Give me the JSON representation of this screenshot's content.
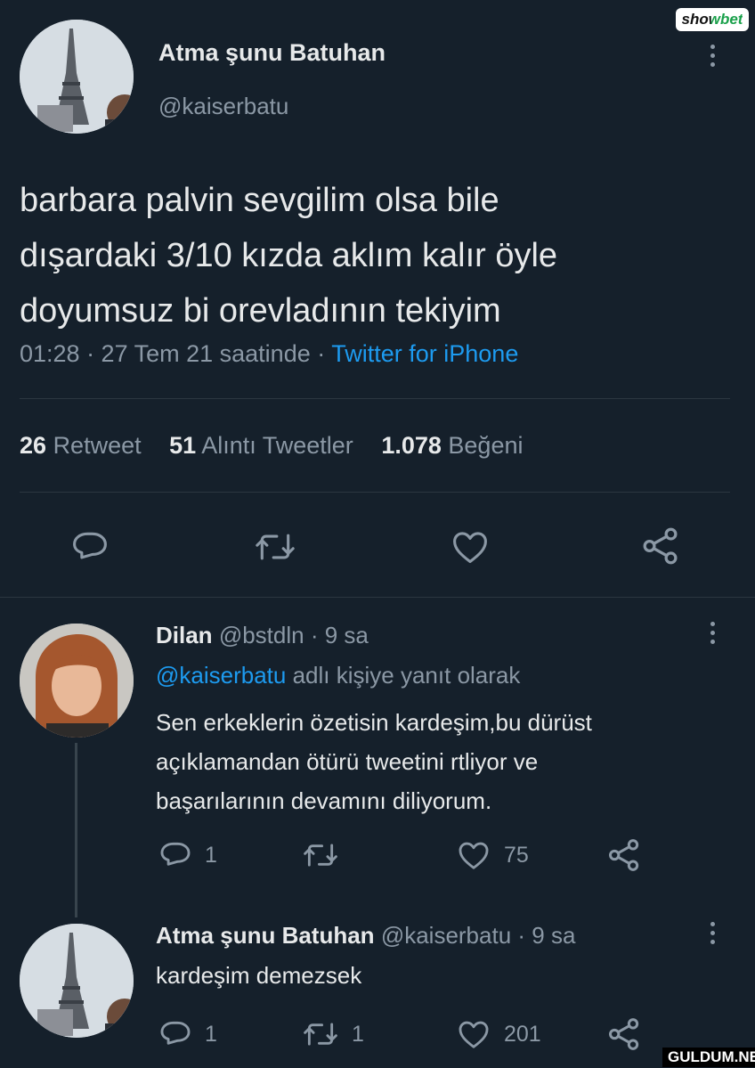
{
  "watermark_top": "showbet",
  "watermark_bottom": "GULDUM.NET",
  "tweet": {
    "author_name": "Atma şunu Batuhan",
    "handle": "@kaiserbatu",
    "text_lines": [
      "barbara palvin sevgilim olsa bile",
      "dışardaki 3/10 kızda aklım kalır öyle",
      "doyumsuz bi orevladının tekiyim"
    ],
    "meta_time": "01:28 · 27 Tem 21 saatinde ·",
    "meta_source": "Twitter for iPhone",
    "stats": {
      "retweet_count": "26",
      "retweet_label": "Retweet",
      "quote_count": "51",
      "quote_label": "Alıntı Tweetler",
      "like_count": "1.078",
      "like_label": "Beğeni"
    }
  },
  "replies": [
    {
      "name": "Dilan",
      "handle": "@bstdln",
      "time": "· 9 sa",
      "reply_to_handle": "@kaiserbatu",
      "reply_to_text": "adlı kişiye yanıt olarak",
      "text_lines": [
        "Sen erkeklerin özetisin kardeşim,bu dürüst",
        "açıklamandan ötürü tweetini rtliyor ve",
        "başarılarının devamını diliyorum."
      ],
      "reply_count": "1",
      "retweet_count": "",
      "like_count": "75"
    },
    {
      "name": "Atma şunu Batuhan",
      "handle": "@kaiserbatu",
      "time": "· 9 sa",
      "text_lines": [
        "kardeşim demezsek"
      ],
      "reply_count": "1",
      "retweet_count": "1",
      "like_count": "201"
    }
  ],
  "colors": {
    "background": "#15202b",
    "text": "#e7e9ea",
    "muted": "#8b98a5",
    "link": "#1d9bf0"
  }
}
